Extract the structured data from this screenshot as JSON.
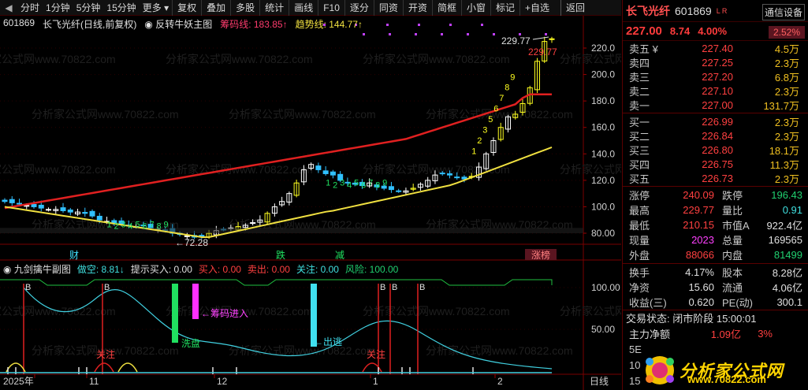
{
  "toolbar": {
    "left_arrow": "◀",
    "items": [
      "分时",
      "1分钟",
      "5分钟",
      "15分钟",
      "更多",
      "复权",
      "叠加",
      "多股",
      "统计",
      "画线",
      "F10",
      "逐分",
      "同资",
      "开资",
      "简框",
      "小窗",
      "标记",
      "+自选"
    ],
    "back": "返回"
  },
  "main_title": {
    "code": "601869",
    "name_period": "长飞光纤(日线,前复权)",
    "indicator": "反转牛妖主图",
    "line1_label": "筹码线: 183.85↑",
    "line2_label": "趋势线: 144.77↑"
  },
  "sub_title": {
    "name": "九剑擒牛副图",
    "short": "做空: 8.81↓",
    "hint_buy": "提示买入: 0.00",
    "buy": "买入: 0.00",
    "sell": "卖出: 0.00",
    "watch": "关注: 0.00",
    "risk": "风险: 100.00"
  },
  "annotations": {
    "high": "229.77",
    "high_inner": "229.77",
    "low": "72.28",
    "wash": "洗盘",
    "chip_in": "筹码进入",
    "exit": "出逃",
    "follow": "关注",
    "follow2": "关注",
    "cai": "财",
    "die": "跌",
    "jian": "减",
    "zhangbang": "涨榜"
  },
  "axis": {
    "y_main": [
      "220.0",
      "200.0",
      "180.0",
      "160.0",
      "140.0",
      "120.0",
      "100.0",
      "80.00"
    ],
    "y_sub": [
      "100.00",
      "50.00"
    ],
    "x": [
      "2025年",
      "11",
      "12",
      "1",
      "2"
    ],
    "x_right": "日线"
  },
  "watermark": "分析家公式网www.70822.com",
  "quote": {
    "name": "长飞光纤",
    "code": "601869",
    "settings": "通信设备",
    "price": "227.00",
    "change": "8.74",
    "pct": "4.00%",
    "ratio": "2.52%",
    "flag": "L R",
    "asks": [
      {
        "label": "卖五 ¥",
        "price": "227.40",
        "vol": "4.5万"
      },
      {
        "label": "卖四",
        "price": "227.25",
        "vol": "2.3万"
      },
      {
        "label": "卖三",
        "price": "227.20",
        "vol": "6.8万"
      },
      {
        "label": "卖二",
        "price": "227.10",
        "vol": "2.3万"
      },
      {
        "label": "卖一",
        "price": "227.00",
        "vol": "131.7万"
      }
    ],
    "bids": [
      {
        "label": "买一",
        "price": "226.99",
        "vol": "2.3万"
      },
      {
        "label": "买二",
        "price": "226.84",
        "vol": "2.3万"
      },
      {
        "label": "买三",
        "price": "226.80",
        "vol": "18.1万"
      },
      {
        "label": "买四",
        "price": "226.75",
        "vol": "11.3万"
      },
      {
        "label": "买五",
        "price": "226.73",
        "vol": "2.3万"
      }
    ],
    "stats1": [
      {
        "k": "涨停",
        "v": "240.09",
        "k2": "跌停",
        "v2": "196.43"
      },
      {
        "k": "最高",
        "v": "229.77",
        "k2": "量比",
        "v2": "0.91"
      },
      {
        "k": "最低",
        "v": "210.15",
        "k2": "市值A",
        "v2": "922.4亿"
      },
      {
        "k": "现量",
        "v": "2023",
        "k2": "总量",
        "v2": "169565"
      },
      {
        "k": "外盘",
        "v": "88066",
        "k2": "内盘",
        "v2": "81499"
      }
    ],
    "stats2": [
      {
        "k": "换手",
        "v": "4.17%",
        "k2": "股本",
        "v2": "8.28亿"
      },
      {
        "k": "净资",
        "v": "15.60",
        "k2": "流通",
        "v2": "4.06亿"
      },
      {
        "k": "收益(三)",
        "v": "0.620",
        "k2": "PE(动)",
        "v2": "300.1"
      }
    ],
    "trade_status": "交易状态: 闭市阶段 15:00:01",
    "fund_label": "主力净额",
    "fund_value": "1.09亿",
    "fund_pct": "3%",
    "five_day": "5E",
    "ten_day": "10",
    "fifteen_day": "15"
  },
  "logo": {
    "text": "分析家公式网",
    "url": "www.70822.com"
  },
  "chart_data": {
    "type": "candlestick",
    "title": "",
    "ylim": [
      72,
      232
    ],
    "series_close": [
      104,
      103,
      102,
      101,
      100,
      99,
      98,
      98,
      97,
      96,
      96,
      95,
      93,
      90,
      89,
      88,
      87,
      86,
      85,
      86,
      84,
      83,
      82,
      80,
      79,
      78,
      77,
      78,
      80,
      82,
      83,
      84,
      85,
      86,
      88,
      90,
      95,
      100,
      104,
      110,
      118,
      128,
      132,
      128,
      125,
      124,
      120,
      118,
      117,
      116,
      118,
      115,
      114,
      113,
      112,
      112,
      114,
      117,
      120,
      124,
      125,
      124,
      122,
      121,
      123,
      130,
      140,
      150,
      160,
      168,
      170,
      178,
      190,
      210,
      225,
      227
    ],
    "chip_line": 183.85,
    "trend_line": 144.77
  }
}
